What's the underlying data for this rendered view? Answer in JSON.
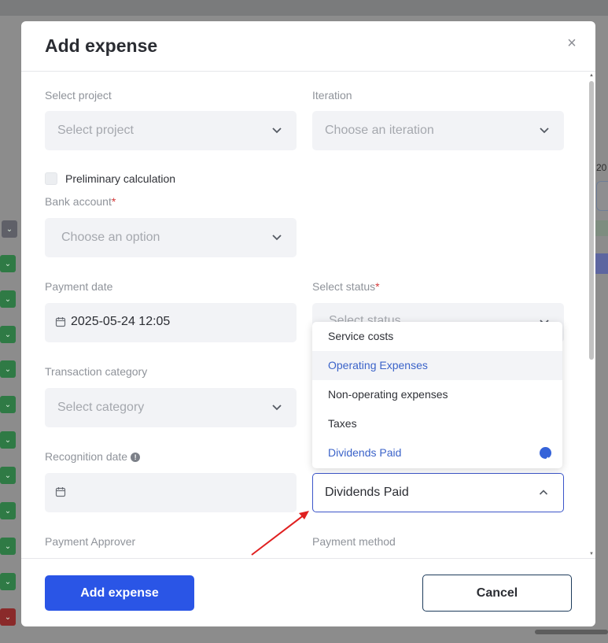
{
  "modal": {
    "title": "Add expense",
    "close_icon": "close-icon"
  },
  "form": {
    "project": {
      "label": "Select project",
      "placeholder": "Select project"
    },
    "iteration": {
      "label": "Iteration",
      "placeholder": "Choose an iteration"
    },
    "preliminary": {
      "label": "Preliminary calculation",
      "checked": false
    },
    "bank_account": {
      "label": "Bank account",
      "required": "*",
      "placeholder": "Choose an option"
    },
    "payment_date": {
      "label": "Payment date",
      "value": "2025-05-24 12:05"
    },
    "status": {
      "label": "Select status",
      "required": "*",
      "placeholder": "Select status"
    },
    "transaction_category": {
      "label": "Transaction category",
      "placeholder": "Select category"
    },
    "recognition_date": {
      "label": "Recognition date",
      "value": ""
    },
    "category_select": {
      "value": "Dividends Paid",
      "options": [
        {
          "label": "Service costs",
          "state": "normal"
        },
        {
          "label": "Operating Expenses",
          "state": "hover"
        },
        {
          "label": "Non-operating expenses",
          "state": "normal"
        },
        {
          "label": "Taxes",
          "state": "normal"
        },
        {
          "label": "Dividends Paid",
          "state": "selected"
        }
      ]
    },
    "payment_approver": {
      "label": "Payment Approver"
    },
    "payment_method": {
      "label": "Payment method"
    }
  },
  "footer": {
    "submit_label": "Add expense",
    "cancel_label": "Cancel"
  },
  "background": {
    "year_fragment": "20"
  },
  "colors": {
    "primary": "#2a55e6",
    "accent_text": "#3b63c9",
    "required": "#d43838",
    "annotation_arrow": "#e02020"
  }
}
